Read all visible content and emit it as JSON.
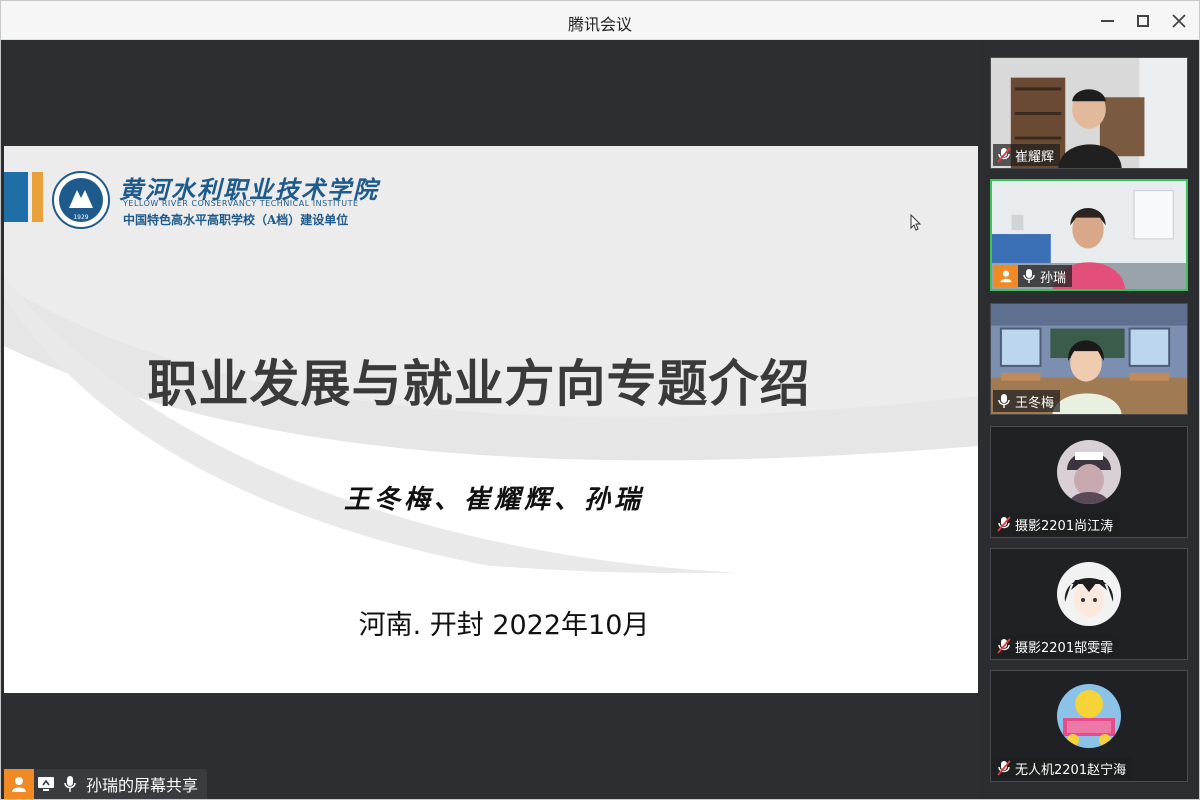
{
  "window": {
    "title": "腾讯会议"
  },
  "slide": {
    "logo_cn": "黄河水利职业技术学院",
    "logo_en": "YELLOW RIVER CONSERVANCY TECHNICAL INSTITUTE",
    "logo_sub": "中国特色高水平高职学校（A档）建设单位",
    "logo_year": "1929",
    "title": "职业发展与就业方向专题介绍",
    "authors": "王冬梅、崔耀辉、孙瑞",
    "place_date": "河南. 开封   2022年10月"
  },
  "share_status": {
    "label": "孙瑞的屏幕共享"
  },
  "participants": [
    {
      "name": "崔耀辉",
      "muted": true,
      "host": false,
      "active": false
    },
    {
      "name": "孙瑞",
      "muted": false,
      "host": true,
      "active": true
    },
    {
      "name": "王冬梅",
      "muted": false,
      "host": false,
      "active": false
    },
    {
      "name": "摄影2201尚江涛",
      "muted": true,
      "host": false,
      "active": false
    },
    {
      "name": "摄影2201郜雯霏",
      "muted": true,
      "host": false,
      "active": false
    },
    {
      "name": "无人机2201赵宁海",
      "muted": true,
      "host": false,
      "active": false
    }
  ],
  "colors": {
    "accent_green": "#3ec15b",
    "host_orange": "#f08a24",
    "logo_blue": "#1f6ea8"
  }
}
